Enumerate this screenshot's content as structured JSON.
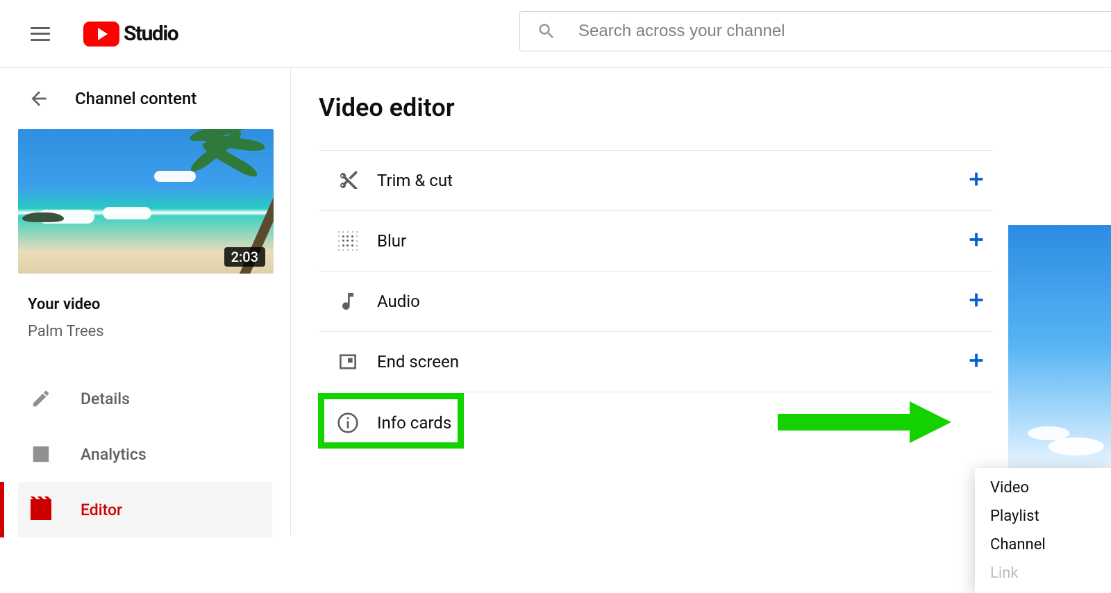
{
  "header": {
    "logo_text": "Studio",
    "search_placeholder": "Search across your channel"
  },
  "sidebar": {
    "back_label": "Channel content",
    "video_duration": "2:03",
    "your_video_label": "Your video",
    "video_title": "Palm Trees",
    "nav": {
      "details": "Details",
      "analytics": "Analytics",
      "editor": "Editor"
    }
  },
  "main": {
    "title": "Video editor",
    "rows": {
      "trim_cut": "Trim & cut",
      "blur": "Blur",
      "audio": "Audio",
      "end_screen": "End screen",
      "info_cards": "Info cards"
    }
  },
  "dropdown": {
    "video": "Video",
    "playlist": "Playlist",
    "channel": "Channel",
    "link": "Link"
  }
}
